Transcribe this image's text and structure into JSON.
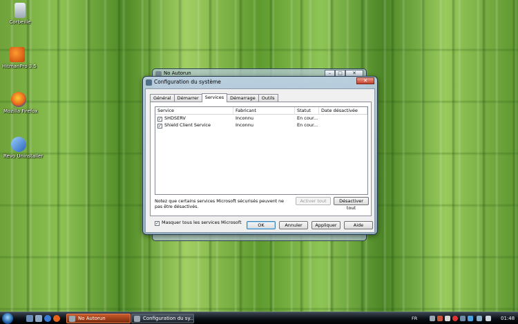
{
  "desktop": {
    "icons": [
      {
        "label": "Corbeille",
        "icon": "recycle-bin-icon"
      },
      {
        "label": "HitmanPro 3.5",
        "icon": "hitmanpro-icon"
      },
      {
        "label": "Mozilla Firefox",
        "icon": "firefox-icon"
      },
      {
        "label": "Revo Uninstaller",
        "icon": "revo-uninstaller-icon"
      }
    ]
  },
  "back_window": {
    "title": "No Autorun",
    "controls": {
      "minimize": "–",
      "maximize": "□",
      "close": "✕"
    }
  },
  "dialog": {
    "title": "Configuration du système",
    "close": "✕",
    "tabs": [
      {
        "label": "Général"
      },
      {
        "label": "Démarrer"
      },
      {
        "label": "Services",
        "active": true
      },
      {
        "label": "Démarrage"
      },
      {
        "label": "Outils"
      }
    ],
    "columns": [
      "Service",
      "Fabricant",
      "Statut",
      "Date désactivée"
    ],
    "rows": [
      {
        "service": "SHDSERV",
        "fabricant": "Inconnu",
        "statut": "En cour...",
        "date": "",
        "checked": true
      },
      {
        "service": "Shield Client Service",
        "fabricant": "Inconnu",
        "statut": "En cour...",
        "date": "",
        "checked": true
      }
    ],
    "note": "Notez que certains services Microsoft sécurisés peuvent ne pas être désactivés.",
    "enable_all": "Activer tout",
    "disable_all": "Désactiver tout",
    "hide_ms_label": "Masquer tous les services Microsoft",
    "hide_ms_checked": true,
    "ok": "OK",
    "cancel": "Annuler",
    "apply": "Appliquer",
    "help": "Aide"
  },
  "taskbar": {
    "tasks": [
      {
        "label": "No Autorun",
        "active": true
      },
      {
        "label": "Configuration du sy...",
        "active": false
      }
    ],
    "language": "FR",
    "clock": "01:48"
  },
  "colors": {
    "dialog_frame": "#a9c2d6",
    "taskbar": "#0b1016",
    "active_task": "#c85a2a",
    "close_button": "#c4412a"
  }
}
